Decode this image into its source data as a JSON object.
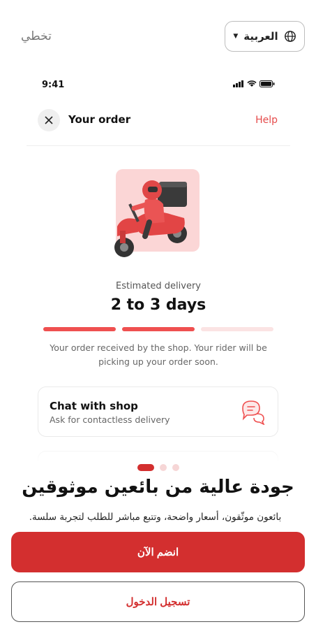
{
  "header": {
    "skip_label": "تخطي",
    "language_label": "العربية"
  },
  "phone": {
    "status_time": "9:41",
    "order_title": "Your order",
    "help_label": "Help",
    "estimated_label": "Estimated delivery",
    "estimated_value": "2 to 3 days",
    "progress": {
      "segments": 3,
      "completed": 2
    },
    "status_message": "Your order received by the shop. Your rider will be picking up your order soon.",
    "chat_card": {
      "title": "Chat with shop",
      "subtitle": "Ask for contactless delivery"
    }
  },
  "onboarding": {
    "page_indicator": {
      "total": 3,
      "active": 1
    },
    "headline": "جودة عالية من بائعين موثوقين",
    "subline": "بائعون موثّقون، أسعار واضحة، وتتبع مباشر للطلب لتجربة سلسة.",
    "join_label": "انضم الآن",
    "login_label": "تسجيل الدخول"
  },
  "colors": {
    "brand": "#d32f2f",
    "accent": "#ef5050",
    "illustration_bg": "#fbd6d6"
  }
}
